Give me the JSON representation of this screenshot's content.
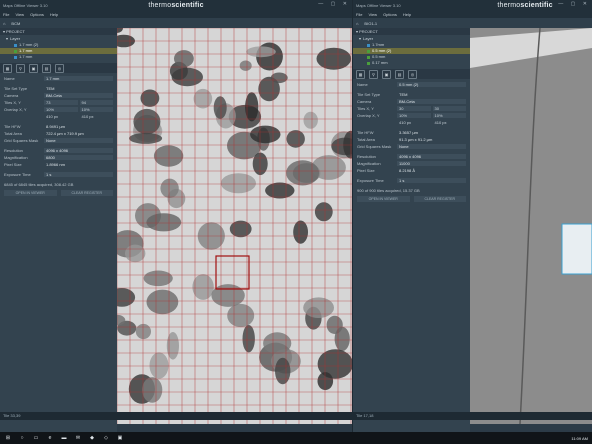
{
  "brand": {
    "light": "thermo",
    "bold": "scientific"
  },
  "left": {
    "title": "Maps Offline Viewer 3.10",
    "menu": [
      "File",
      "View",
      "Options",
      "Help"
    ],
    "toolbar": "BCM",
    "project_label": "PROJECT",
    "layers_label": "Layer",
    "tree": [
      {
        "label": "1.7 mm (2)",
        "selected": false
      },
      {
        "label": "1.7 mm",
        "selected": true
      },
      {
        "label": "1.7 mm",
        "selected": false
      }
    ],
    "props": {
      "name_k": "Name",
      "name_v": "1.7 mm",
      "tst_k": "Tile Set Type",
      "tst_v": "TEM",
      "cam_k": "Camera",
      "cam_v": "BM-Ceta",
      "tiles_k": "Tiles X, Y",
      "tiles_x": "73",
      "tiles_y": "94",
      "ov_k": "Overlap X, Y",
      "ov_x": "10%",
      "ov_y": "10%",
      "offset_a": "410 px",
      "offset_b": "410 px",
      "hfw_k": "Tile HFW",
      "hfw_v": "8.9491 µm",
      "area_k": "Total Area",
      "area_v": "722.4 µm x 719.9 µm",
      "grid_k": "Grid Squares Mask",
      "grid_v": "None",
      "res_k": "Resolution",
      "res_v": "4096 x 4096",
      "mag_k": "Magnification",
      "mag_v": "6800",
      "px_k": "Pixel Size",
      "px_v": "1.8966 nm",
      "exp_k": "Exposure Time",
      "exp_v": "1 s",
      "status": "6845 of 6845 tiles acquired, 308.42 GB",
      "btn1": "OPEN IN VIEWER",
      "btn2": "CLEAR REGISTER"
    },
    "footer": "Tile 33,39"
  },
  "right": {
    "title": "Maps Offline Viewer 3.10",
    "menu": [
      "File",
      "View",
      "Options",
      "Help"
    ],
    "toolbar": "BIO1-1",
    "project_label": "PROJECT",
    "layers_label": "Layer",
    "tree": [
      {
        "label": "1.7mm",
        "selected": false
      },
      {
        "label": "0.5 mm (2)",
        "selected": true
      },
      {
        "label": "0.5 mm",
        "selected": false
      },
      {
        "label": "0.17 mm",
        "selected": false
      }
    ],
    "props": {
      "name_k": "Name",
      "name_v": "0.5 mm (2)",
      "tst_k": "Tile Set Type",
      "tst_v": "TEM",
      "cam_k": "Camera",
      "cam_v": "BM-Ceta",
      "tiles_k": "Tiles X, Y",
      "tiles_x": "30",
      "tiles_y": "30",
      "ov_k": "Overlap X, Y",
      "ov_x": "10%",
      "ov_y": "10%",
      "offset_a": "410 px",
      "offset_b": "410 px",
      "hfw_k": "Tile HFW",
      "hfw_v": "3.3657 µm",
      "area_k": "Total Area",
      "area_v": "91.3 µm x 91.2 µm",
      "grid_k": "Grid Squares Mask",
      "grid_v": "None",
      "res_k": "Resolution",
      "res_v": "4096 x 4096",
      "mag_k": "Magnification",
      "mag_v": "11000",
      "px_k": "Pixel Size",
      "px_v": "8.2198 Å",
      "exp_k": "Exposure Time",
      "exp_v": "1 s",
      "status": "900 of 900 tiles acquired, 15.37 GB",
      "btn1": "OPEN IN VIEWER",
      "btn2": "CLEAR REGISTER"
    },
    "footer": "Tile 17,18"
  },
  "taskbar": {
    "clock": "11:09 AM"
  }
}
